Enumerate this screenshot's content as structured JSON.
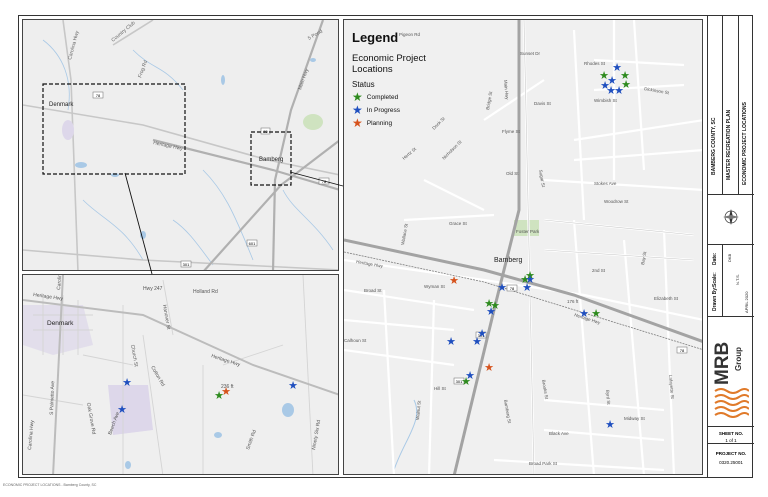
{
  "legend": {
    "title": "Legend",
    "subtitle": "Economic Project Locations",
    "status_label": "Status",
    "items": [
      {
        "label": "Completed",
        "color": "#2e8b1e"
      },
      {
        "label": "In Progress",
        "color": "#1f4fbf"
      },
      {
        "label": "Planning",
        "color": "#d6521c"
      }
    ]
  },
  "overview": {
    "box_labels": [
      "Denmark",
      "Bamberg"
    ],
    "road_labels": [
      "Heritage Hwy",
      "Carolina Hwy",
      "Country Club",
      "Frog Rd",
      "Main Hwy",
      "78",
      "301",
      "601",
      "70",
      "5 Pond"
    ]
  },
  "inset": {
    "town": "Denmark",
    "labels": [
      "Heritage Hwy",
      "Carolina Hwy",
      "Holland Rd",
      "S Palmetto Ave",
      "Church St",
      "Beech Ave",
      "Oak Grove Rd",
      "Cotton Rd",
      "Hanover St",
      "Sycamore St",
      "Ashton Rd",
      "Hutchinson Rd",
      "Smith Rd",
      "Ninety Six Rd",
      "Jordan Rd",
      "Rockmore Dr",
      "Carolina Hwy",
      "Hwy 247"
    ],
    "elevation": "236 ft"
  },
  "main": {
    "town": "Bamberg",
    "park": "Foster Park",
    "elevation": "176 ft",
    "labels": [
      "Pigeon Rd",
      "Rhodes St",
      "Cedar St",
      "Wimbish St",
      "Davis St",
      "Dickinson St",
      "Sunset Dr",
      "Lindsay Dr",
      "Jamison Dr",
      "Dock St",
      "Hertz St",
      "Nicholson St",
      "Bridge St",
      "Flyme St",
      "Old St",
      "Carlisle St",
      "Sugar St",
      "Grace St",
      "Wallace St",
      "Baker St",
      "Stokes Ave",
      "Woodrow St",
      "Hunter Rd",
      "Dickson Rd",
      "Sheriff Rd",
      "2nd St",
      "Bay St",
      "Elizabeth St",
      "Main Hwy",
      "Heritage Hwy",
      "Railroad Ave",
      "Elm St",
      "Broad St",
      "Wyman St",
      "Calhoun St",
      "Walnut St",
      "Hill St",
      "Black Ave",
      "Broad Park St",
      "Midway St",
      "Lafayette St",
      "Church St",
      "Bamberg St",
      "Brooks St",
      "Byrd St"
    ],
    "route_shields": [
      "78",
      "78",
      "301",
      "301",
      "601"
    ]
  },
  "title_block": {
    "client": "BAMBERG COUNTY, SC",
    "project": "MASTER RECREATION PLAN",
    "sheet_title": "ECONOMIC PROJECT LOCATIONS",
    "drawn_by_label": "Drawn By:",
    "drawn_by": "DKB",
    "scale_label": "Scale:",
    "scale": "N.T.S.",
    "date_label": "Date:",
    "date": "APRIL 2020",
    "firm": "MRB",
    "firm_sub": "Group",
    "sheet_no_label": "SHEET NO.",
    "sheet_no": "1 of 1",
    "project_no_label": "PROJECT NO.",
    "project_no": "0320.25001"
  },
  "footer": "ECONOMIC PROJECT LOCATIONS - Bamberg County, SC"
}
